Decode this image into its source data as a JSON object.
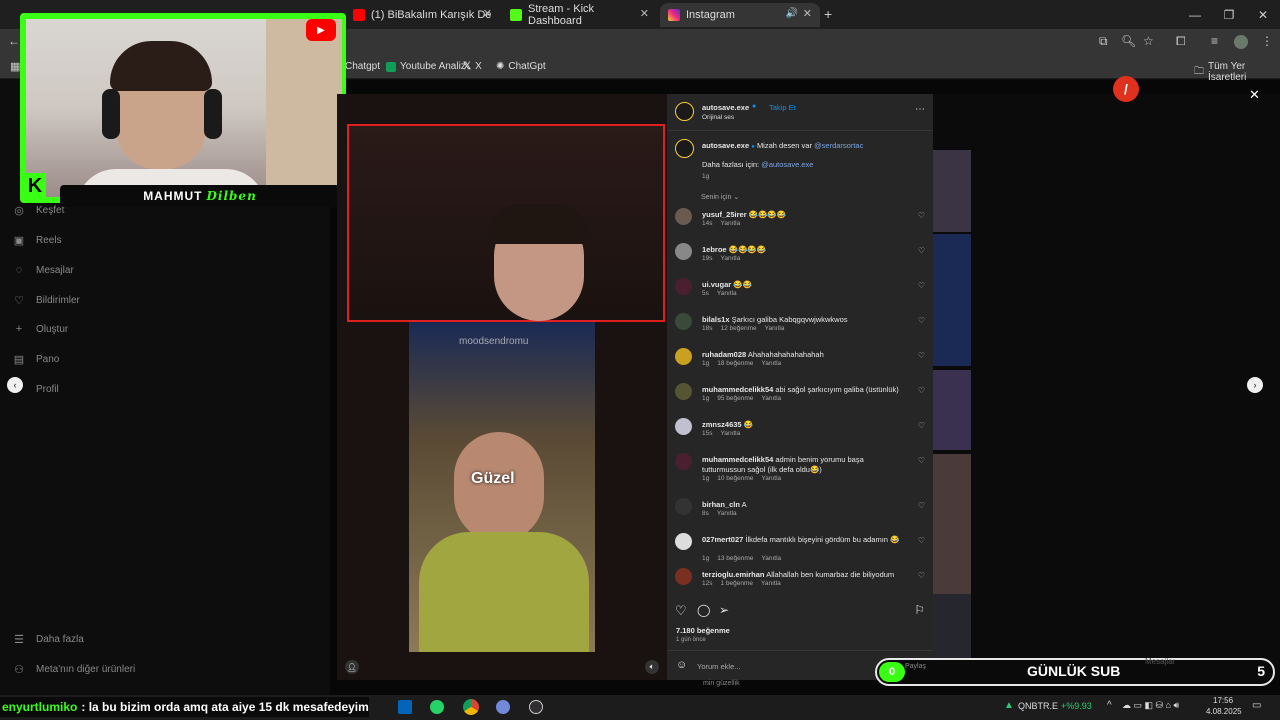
{
  "tabs": [
    {
      "label": "(1) BiBakalım Karışık Derleme #"
    },
    {
      "label": "Stream - Kick Dashboard"
    },
    {
      "label": "Instagram"
    }
  ],
  "bookmarks": [
    {
      "label": "Chatgpt"
    },
    {
      "label": "Youtube Analiz"
    },
    {
      "label": "X"
    },
    {
      "label": "ChatGpt"
    },
    {
      "label": "Tüm Yer İşaretleri"
    }
  ],
  "leftnav": [
    {
      "label": "Keşfet",
      "icon": "compass-icon"
    },
    {
      "label": "Reels",
      "icon": "reels-icon"
    },
    {
      "label": "Mesajlar",
      "icon": "messenger-icon"
    },
    {
      "label": "Bildirimler",
      "icon": "heart-icon"
    },
    {
      "label": "Oluştur",
      "icon": "plus-icon"
    },
    {
      "label": "Pano",
      "icon": "chart-icon"
    },
    {
      "label": "Profil",
      "icon": "profile-icon"
    },
    {
      "label": "Daha fazla",
      "icon": "menu-icon"
    },
    {
      "label": "Meta'nın diğer ürünleri",
      "icon": "meta-icon"
    }
  ],
  "webcam": {
    "name": "MAHMUT",
    "script": "Dilben"
  },
  "video": {
    "watermark": "moodsendromu",
    "caption": "Güzel"
  },
  "post": {
    "author": "autosave.exe",
    "follow": "Takip Et",
    "audio": "Orijinal ses",
    "caption_user": "autosave.exe",
    "caption": "Mizah desen var",
    "caption_mention": "@serdarsortac",
    "caption_line2": "Daha fazlası için:",
    "caption_mention2": "@autosave.exe",
    "caption_time": "1g",
    "sort_label": "Senin için",
    "likes": "7.180 beğenme",
    "posted": "1 gün önce",
    "comment_placeholder": "Yorum ekle..."
  },
  "comments": [
    {
      "user": "yusuf_25irer",
      "text": "😂😂😂😂",
      "time": "14s",
      "likes": "",
      "reply": "Yanıtla"
    },
    {
      "user": "1ebroe",
      "text": "😂😂😂😂",
      "time": "19s",
      "likes": "",
      "reply": "Yanıtla"
    },
    {
      "user": "ui.vugar",
      "text": "😂😂",
      "time": "5s",
      "likes": "",
      "reply": "Yanıtla"
    },
    {
      "user": "bilals1x",
      "text": "Şarkıcı galiba Kabqgqvwjwkwkwos",
      "time": "18s",
      "likes": "12 beğenme",
      "reply": "Yanıtla"
    },
    {
      "user": "ruhadam028",
      "text": "Ahahahahahahahahah",
      "time": "1g",
      "likes": "18 beğenme",
      "reply": "Yanıtla"
    },
    {
      "user": "muhammedcelikk54",
      "text": "abi sağol şarkıcıyım galiba (üstünlük)",
      "time": "1g",
      "likes": "95 beğenme",
      "reply": "Yanıtla"
    },
    {
      "user": "zmnsz4635",
      "text": "😂",
      "time": "15s",
      "likes": "",
      "reply": "Yanıtla"
    },
    {
      "user": "muhammedcelikk54",
      "text": "admin benim yorumu başa tutturmussun sağol (ilk defa oldu😂)",
      "time": "1g",
      "likes": "10 beğenme",
      "reply": "Yanıtla"
    },
    {
      "user": "birhan_cln",
      "text": "A",
      "time": "8s",
      "likes": "",
      "reply": "Yanıtla"
    },
    {
      "user": "027mert027",
      "text": "İlkdefa mantıklı bişeyini gördüm bu adamın 😂",
      "time": "1g",
      "likes": "13 beğenme",
      "reply": "Yanıtla"
    },
    {
      "user": "terzioglu.emirhan",
      "text": "Allahallah ben kumarbaz die biliyodum",
      "time": "12s",
      "likes": "1 beğenme",
      "reply": "Yanıtla"
    }
  ],
  "overlay": {
    "chat_user": "enyurtlumiko",
    "chat_message": ": la bu bizim orda amq ata aiye 15 dk mesafedeyim",
    "sub_label": "GÜNLÜK SUB",
    "sub_count": "0",
    "sub_goal": "5",
    "share_label": "Paylaş",
    "messages_label": "Mesajlar",
    "partial_text": "min güzellik"
  },
  "taskbar": {
    "ticker": "QNBTR.E",
    "ticker_change": "+%9.93",
    "time": "17:56",
    "date": "4.08.2025"
  },
  "colors": {
    "accent": "#39ff14",
    "instagram_blue": "#0095f6",
    "panel_bg": "#262626"
  }
}
